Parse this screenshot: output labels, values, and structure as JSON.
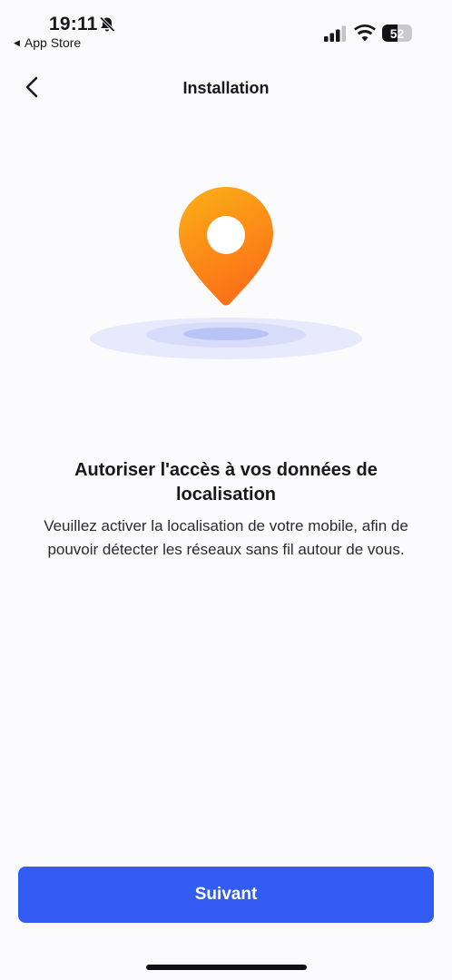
{
  "status_bar": {
    "time": "19:11",
    "back_app_label": "App Store",
    "battery_level": "52",
    "icons": [
      "bell-slash-icon",
      "signal-icon",
      "wifi-icon",
      "battery-icon"
    ]
  },
  "nav": {
    "title": "Installation",
    "back_icon": "chevron-left-icon"
  },
  "illustration": {
    "icon": "location-pin-icon",
    "pin_color_top": "#fdb015",
    "pin_color_bottom": "#fb7218",
    "ring_color": "#e7eafc"
  },
  "content": {
    "heading": "Autoriser l'accès à vos données de localisation",
    "description": "Veuillez activer la localisation de votre mobile, afin de pouvoir détecter les réseaux sans fil autour de vous."
  },
  "footer": {
    "next_label": "Suivant",
    "accent_color": "#335cf2"
  }
}
